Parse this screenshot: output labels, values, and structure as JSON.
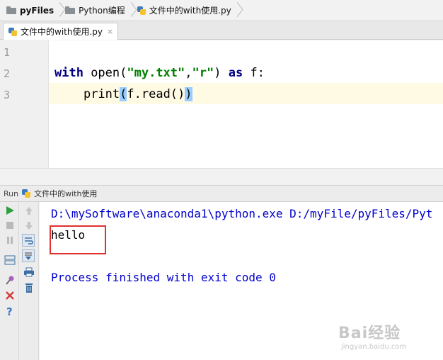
{
  "breadcrumb": {
    "project": "pyFiles",
    "folder": "Python编程",
    "file": "文件中的with使用.py"
  },
  "editor_tab": {
    "label": "文件中的with使用.py",
    "close": "×"
  },
  "editor": {
    "line_numbers": [
      "1",
      "2",
      "3"
    ],
    "code": {
      "line2_kw_with": "with",
      "line2_func": " open(",
      "line2_arg1": "\"my.txt\"",
      "line2_comma": ",",
      "line2_arg2": "\"r\"",
      "line2_close": ") ",
      "line2_kw_as": "as",
      "line2_tail": " f:",
      "line3_indent": "    ",
      "line3_func": "print",
      "line3_open": "(",
      "line3_mid": "f.read()",
      "line3_close": ")"
    }
  },
  "run_panel": {
    "label": "Run",
    "config_name": "文件中的with使用",
    "console": {
      "command": "D:\\mySoftware\\anaconda1\\python.exe D:/myFile/pyFiles/Pyt",
      "output": "hello",
      "finished": "Process finished with exit code 0"
    }
  },
  "watermark": {
    "brand": "Bai经验",
    "url": "jingyan.baidu.com"
  },
  "colors": {
    "keyword": "#000080",
    "string": "#008000",
    "console_blue": "#0000cc",
    "highlight_box": "#e03030",
    "current_line": "#fffae3"
  }
}
